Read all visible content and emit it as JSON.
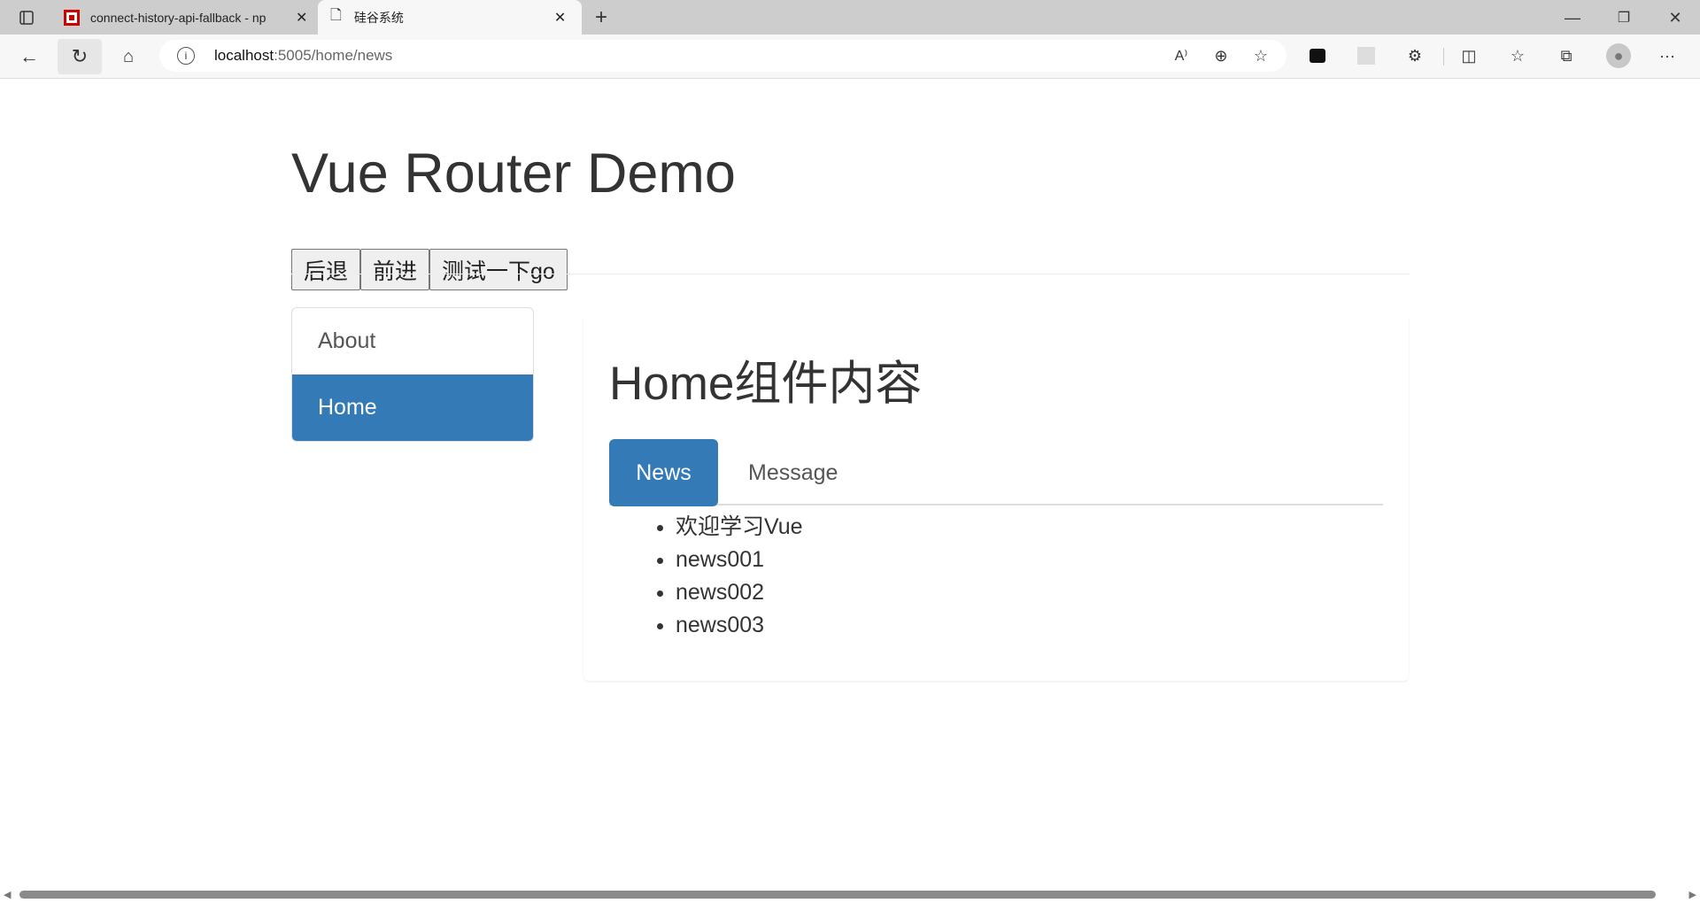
{
  "browser": {
    "tabs": [
      {
        "title": "connect-history-api-fallback - np",
        "icon": "npm-icon"
      },
      {
        "title": "硅谷系统",
        "icon": "page-icon",
        "active": true
      }
    ],
    "url_host": "localhost",
    "url_path": ":5005/home/news",
    "colors": {
      "npm": "#cb0000"
    }
  },
  "header": {
    "title": "Vue Router Demo",
    "buttons": [
      "后退",
      "前进",
      "测试一下go"
    ]
  },
  "sidebar": {
    "items": [
      {
        "label": "About"
      },
      {
        "label": "Home",
        "active": true
      }
    ]
  },
  "main": {
    "title": "Home组件内容",
    "tabs": [
      {
        "label": "News",
        "active": true
      },
      {
        "label": "Message"
      }
    ],
    "news": [
      "欢迎学习Vue",
      "news001",
      "news002",
      "news003"
    ]
  },
  "colors": {
    "accent": "#337ab7"
  }
}
